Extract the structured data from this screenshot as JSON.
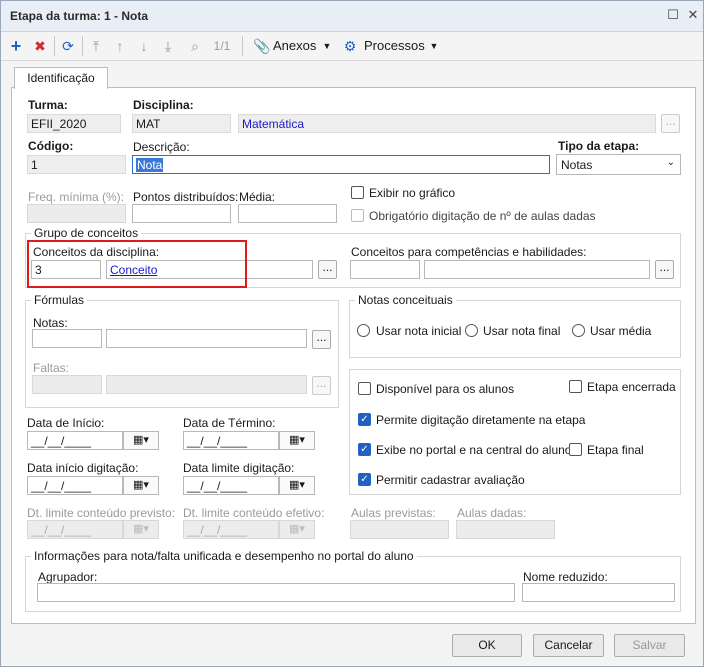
{
  "window": {
    "title": "Etapa da turma: 1 - Nota"
  },
  "toolbar": {
    "record_count": "1/1",
    "anexos": "Anexos",
    "processos": "Processos"
  },
  "tab": {
    "label": "Identificação"
  },
  "form": {
    "turma": {
      "label": "Turma:",
      "value": "EFII_2020"
    },
    "disciplina": {
      "label": "Disciplina:",
      "code": "MAT",
      "name": "Matemática"
    },
    "codigo": {
      "label": "Código:",
      "value": "1"
    },
    "descricao": {
      "label": "Descrição:",
      "value": "Nota"
    },
    "tipo": {
      "label": "Tipo da etapa:",
      "value": "Notas"
    },
    "freq": {
      "label": "Freq. mínima (%):"
    },
    "pontos": {
      "label": "Pontos distribuídos:"
    },
    "media": {
      "label": "Média:"
    },
    "exibir_grafico": "Exibir no gráfico",
    "obrigatorio": "Obrigatório digitação de nº de aulas dadas",
    "grupo_conceitos": {
      "title": "Grupo de conceitos",
      "conceitos_disciplina_label": "Conceitos da disciplina:",
      "conceito_code": "3",
      "conceito_name": "Conceito",
      "competencias_label": "Conceitos para competências e habilidades:"
    },
    "formulas": {
      "title": "Fórmulas",
      "notas": "Notas:",
      "faltas": "Faltas:"
    },
    "notas_conceituais": {
      "title": "Notas conceituais",
      "options": [
        "Usar nota inicial",
        "Usar nota final",
        "Usar média"
      ]
    },
    "flags": {
      "disponivel": "Disponível para os alunos",
      "encerrada": "Etapa encerrada",
      "permite_digitacao": "Permite digitação diretamente na etapa",
      "exibe_portal": "Exibe no portal e na central do aluno",
      "etapa_final": "Etapa final",
      "permitir_avaliacao": "Permitir cadastrar avaliação"
    },
    "dates": {
      "inicio": "Data de Início:",
      "termino": "Data de Término:",
      "inicio_digitacao": "Data início digitação:",
      "limite_digitacao": "Data limite digitação:",
      "limite_previsto": "Dt. limite conteúdo previsto:",
      "limite_efetivo": "Dt. limite conteúdo efetivo:",
      "placeholder": "__/__/____"
    },
    "aulas_previstas": "Aulas previstas:",
    "aulas_dadas": "Aulas dadas:",
    "info_group": {
      "title": "Informações para nota/falta unificada e desempenho no portal do aluno",
      "agrupador": "Agrupador:",
      "nome_reduzido": "Nome reduzido:"
    }
  },
  "buttons": {
    "ok": "OK",
    "cancelar": "Cancelar",
    "salvar": "Salvar"
  },
  "colors": {
    "accent": "#2160c4",
    "highlight_box": "#e01a1a",
    "link": "#1a1acc"
  }
}
